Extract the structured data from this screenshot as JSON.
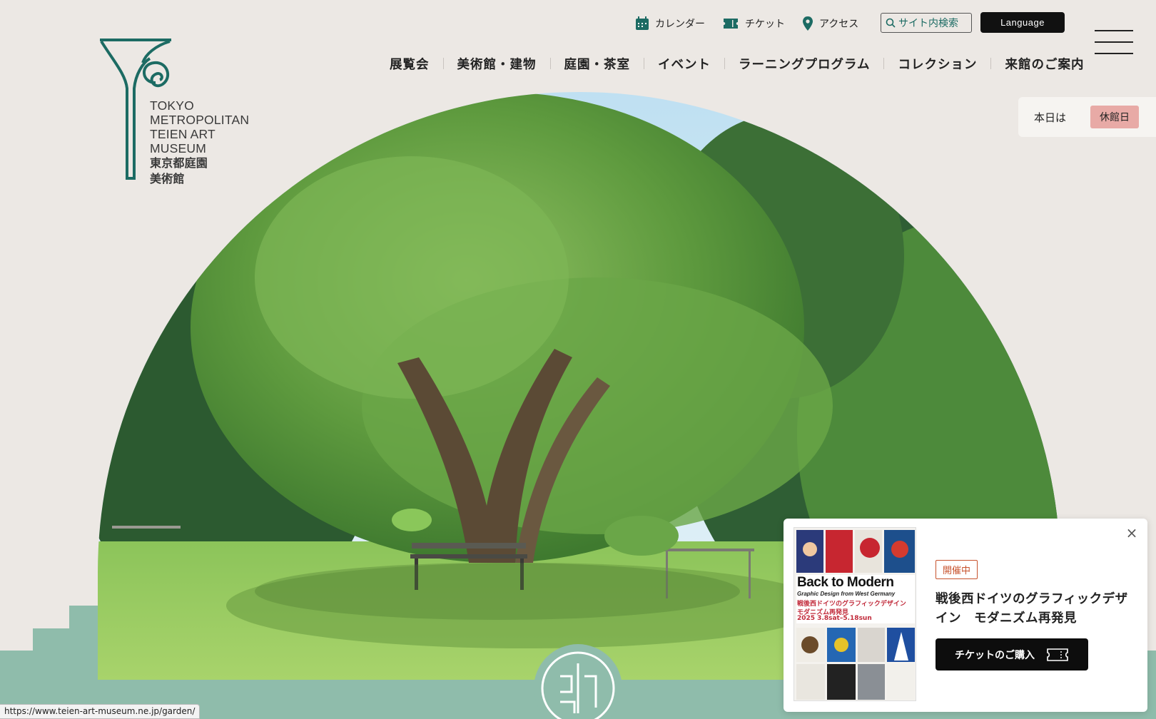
{
  "logo": {
    "en_lines": [
      "TOKYO",
      "METROPOLITAN",
      "TEIEN ART",
      "MUSEUM"
    ],
    "ja_lines": [
      "東京都庭園",
      "美術館"
    ]
  },
  "utility": {
    "calendar": "カレンダー",
    "ticket": "チケット",
    "access": "アクセス",
    "search_placeholder": "サイト内検索",
    "language": "Language"
  },
  "nav": [
    {
      "label": "展覧会"
    },
    {
      "label": "美術館・建物"
    },
    {
      "label": "庭園・茶室"
    },
    {
      "label": "イベント"
    },
    {
      "label": "ラーニングプログラム"
    },
    {
      "label": "コレクション"
    },
    {
      "label": "来館のご案内"
    }
  ],
  "today": {
    "label": "本日は",
    "status": "休館日"
  },
  "popup": {
    "status": "開催中",
    "title": "戦後西ドイツのグラフィックデザイン　モダニズム再発見",
    "button": "チケットのご購入",
    "close": "×",
    "poster": {
      "headline": "Back to Modern",
      "subtitle": "Graphic Design from West Germany",
      "ja_line1": "戦後西ドイツのグラフィックデザイン",
      "ja_line2": "モダニズム再発見",
      "dates": "2025 3.8sat–5.18sun"
    }
  },
  "status_url": "https://www.teien-art-museum.ne.jp/garden/",
  "colors": {
    "background": "#ece8e4",
    "brand_green": "#1c6b63",
    "band_green": "#8fbcab",
    "closed_badge": "#e8aaa6",
    "status_tag": "#c7522c"
  }
}
